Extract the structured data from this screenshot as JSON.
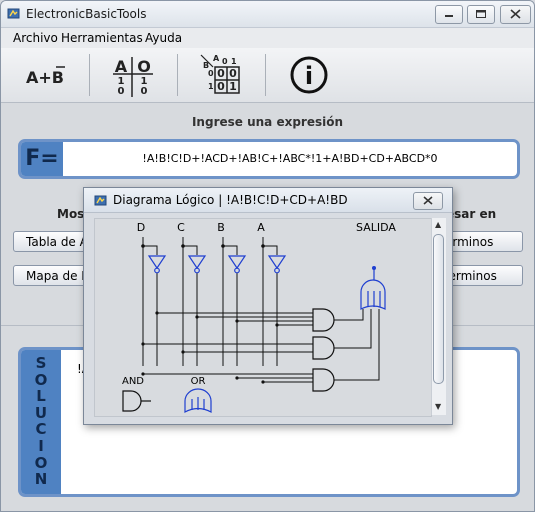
{
  "window": {
    "title": "ElectronicBasicTools",
    "minimize": "▭",
    "restore": "▢",
    "close": "✕"
  },
  "menu": [
    "Archivo",
    "Herramientas",
    "Ayuda"
  ],
  "toolbar": {
    "algebra_label": "A+B",
    "table_header": [
      "A",
      "O"
    ],
    "table_rows": [
      [
        "1",
        "1"
      ],
      [
        "0",
        "0"
      ]
    ],
    "kmap_corner_a": "A",
    "kmap_corner_b": "B",
    "kmap_col_labels": [
      "0",
      "1"
    ],
    "kmap_row_labels": [
      "0",
      "1"
    ],
    "kmap_cells": [
      [
        "0",
        "0"
      ],
      [
        "0",
        "1"
      ]
    ],
    "info_label": "i"
  },
  "main": {
    "prompt": "Ingrese una expresión",
    "f_label": "F",
    "expression": "!A!B!C!D+!ACD+!AB!C+!ABC*!1+A!BD+CD+ABCD*0",
    "show_label": "Mostr",
    "express_label": "esar en",
    "btn_truth_table": "Tabla de A",
    "btn_kmap": "Mapa de K",
    "btn_minterms": "Minterminos",
    "btn_maxterms": "Maxterminos",
    "solution_letters": [
      "S",
      "O",
      "L",
      "U",
      "C",
      "I",
      "O",
      "N"
    ],
    "solution_text": "!A"
  },
  "popup": {
    "title": "Diagrama Lógico | !A!B!C!D+CD+A!BD",
    "inputs": [
      "D",
      "C",
      "B",
      "A"
    ],
    "output_label": "SALIDA",
    "legend_and": "AND",
    "legend_or": "OR",
    "close": "✕",
    "accent_color": "#1f3fd0"
  }
}
